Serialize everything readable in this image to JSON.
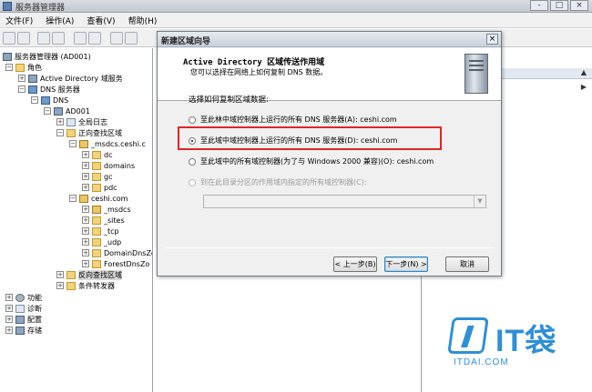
{
  "window": {
    "title": "服务器管理器",
    "controls": [
      "-",
      "□",
      "×"
    ]
  },
  "menubar": [
    "文件(F)",
    "操作(A)",
    "查看(V)",
    "帮助(H)"
  ],
  "tree": {
    "root": "服务器管理器 (AD001)",
    "roles": "角色",
    "ad_service": "Active Directory 域服务",
    "dns_server": "DNS 服务器",
    "dns": "DNS",
    "host": "AD001",
    "global_logs": "全局日志",
    "forward_zones": "正向查找区域",
    "msdcs_zone": "_msdcs.ceshi.c",
    "msdcs_children": [
      "dc",
      "domains",
      "gc",
      "pdc"
    ],
    "ceshi_zone": "ceshi.com",
    "ceshi_children": [
      "_msdcs",
      "_sites",
      "_tcp",
      "_udp",
      "DomainDnsZo",
      "ForestDnsZo"
    ],
    "reverse_zones": "反向查找区域",
    "forwarders": "条件转发器",
    "features": "功能",
    "diagnostics": "诊断",
    "configuration": "配置",
    "storage": "存储"
  },
  "dialog": {
    "title": "新建区域向导",
    "close": "×",
    "header_title": "Active Directory 区域传送作用域",
    "header_subtitle": "您可以选择在网络上如何复制 DNS 数据。",
    "prompt": "选择如何复制区域数据:",
    "options": [
      {
        "label": "至此林中域控制器上运行的所有 DNS 服务器(A): ceshi.com",
        "selected": false,
        "enabled": true
      },
      {
        "label": "至此域中域控制器上运行的所有 DNS 服务器(D): ceshi.com",
        "selected": true,
        "enabled": true
      },
      {
        "label": "至此域中的所有域控制器(为了与 Windows 2000 兼容)(O): ceshi.com",
        "selected": false,
        "enabled": true
      },
      {
        "label": "到在此目录分区的作用域内指定的所有域控制器(C):",
        "selected": false,
        "enabled": false
      }
    ],
    "buttons": {
      "back": "< 上一步(B)",
      "next": "下一步(N) >",
      "cancel": "取消"
    }
  },
  "watermark": {
    "brand": "IT袋",
    "url": "ITDAI.COM"
  },
  "colors": {
    "highlight": "#e02525",
    "watermark": "#2f8fd6"
  }
}
